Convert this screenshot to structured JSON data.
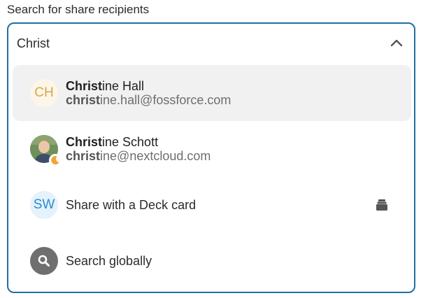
{
  "field": {
    "label": "Search for share recipients",
    "query": "Christ"
  },
  "options": [
    {
      "avatar_text": "CH",
      "name_match": "Christ",
      "name_rest": "ine Hall",
      "email_match": "christ",
      "email_rest": "ine.hall@fossforce.com"
    },
    {
      "avatar_text": "",
      "name_match": "Christ",
      "name_rest": "ine Schott",
      "email_match": "christ",
      "email_rest": "ine@nextcloud.com"
    },
    {
      "avatar_text": "SW",
      "label": "Share with a Deck card"
    },
    {
      "label": "Search globally"
    }
  ],
  "colors": {
    "accent": "#1f6fa3",
    "hover": "#f1f1f1",
    "initials_ch": "#d8a64a",
    "initials_sw": "#2b8ed0",
    "status_away": "#f4a331"
  },
  "icons": {
    "chevron": "chevron-up-icon",
    "status": "moon-icon",
    "deck": "deck-stack-icon",
    "search": "search-icon"
  }
}
